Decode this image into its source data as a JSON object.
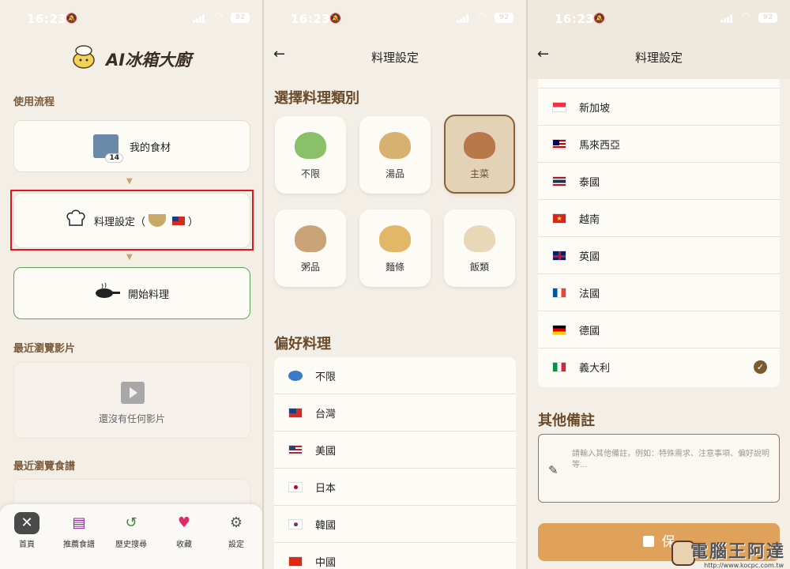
{
  "status": {
    "time": "16:23",
    "battery": "92"
  },
  "home": {
    "app_title": "AI冰箱大廚",
    "section_flow": "使用流程",
    "card_ingredients": "我的食材",
    "ingredients_count": "14",
    "card_settings": "料理設定（",
    "card_settings_end": "）",
    "card_start": "開始料理",
    "section_recent_videos": "最近瀏覽影片",
    "no_videos": "還沒有任何影片",
    "section_recent_recipes": "最近瀏覽食譜",
    "tabs": [
      {
        "label": "首頁",
        "icon": "utensils-icon"
      },
      {
        "label": "推薦食譜",
        "icon": "recipe-book-icon"
      },
      {
        "label": "歷史搜尋",
        "icon": "history-icon"
      },
      {
        "label": "收藏",
        "icon": "heart-icon"
      },
      {
        "label": "設定",
        "icon": "gear-icon"
      }
    ]
  },
  "settings": {
    "title": "料理設定",
    "category_heading": "選擇料理類別",
    "categories": [
      {
        "label": "不限",
        "selected": false
      },
      {
        "label": "湯品",
        "selected": false
      },
      {
        "label": "主菜",
        "selected": true
      },
      {
        "label": "粥品",
        "selected": false
      },
      {
        "label": "麵條",
        "selected": false
      },
      {
        "label": "飯類",
        "selected": false
      }
    ],
    "preference_heading": "偏好料理",
    "cuisines_top": [
      "不限",
      "台灣",
      "美國",
      "日本",
      "韓國",
      "中國"
    ],
    "cuisines_scrolled": [
      "新加坡",
      "馬來西亞",
      "泰國",
      "越南",
      "英國",
      "法國",
      "德國",
      "義大利"
    ],
    "selected_cuisine": "義大利",
    "notes_heading": "其他備註",
    "notes_placeholder": "請輸入其他備註，例如：特殊需求、注意事項、偏好說明等...",
    "save_label": "保"
  },
  "watermark": {
    "text": "電腦王阿達",
    "url": "http://www.kocpc.com.tw"
  },
  "colors": {
    "accent": "#e0a25a",
    "highlight": "#e0161c",
    "selected_bg": "#e4d2b6"
  }
}
